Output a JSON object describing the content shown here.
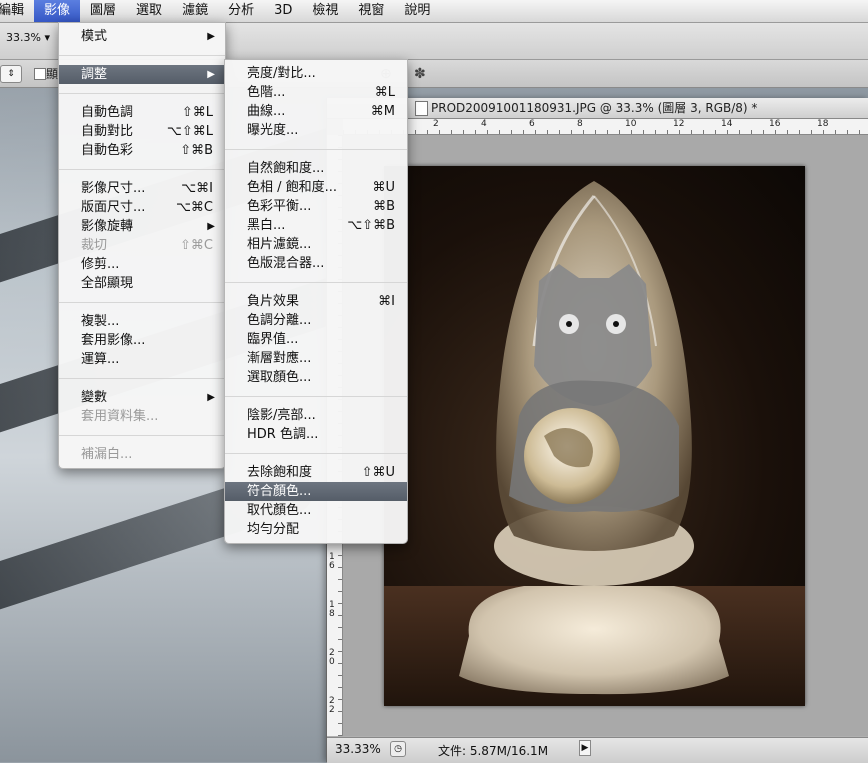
{
  "menubar": [
    "編輯",
    "影像",
    "圖層",
    "選取",
    "濾鏡",
    "分析",
    "3D",
    "檢視",
    "視窗",
    "說明"
  ],
  "menubar_active_index": 1,
  "options": {
    "zoom_value": "33.3%"
  },
  "secondary": {
    "checkbox_label": "顯"
  },
  "document": {
    "title": "PROD20091001180931.JPG @ 33.3% (圖層 3, RGB/8) *",
    "ruler_h": [
      "2",
      "4",
      "6",
      "8",
      "10",
      "12",
      "14",
      "16",
      "18"
    ],
    "ruler_v": [
      "16",
      "18",
      "20",
      "22"
    ],
    "status_zoom": "33.33%",
    "status_info": "文件: 5.87M/16.1M"
  },
  "image_menu": {
    "groups": [
      [
        {
          "label": "模式",
          "submenu": true
        }
      ],
      [
        {
          "label": "調整",
          "submenu": true,
          "highlight": true
        }
      ],
      [
        {
          "label": "自動色調",
          "shortcut": "⇧⌘L"
        },
        {
          "label": "自動對比",
          "shortcut": "⌥⇧⌘L"
        },
        {
          "label": "自動色彩",
          "shortcut": "⇧⌘B"
        }
      ],
      [
        {
          "label": "影像尺寸...",
          "shortcut": "⌥⌘I"
        },
        {
          "label": "版面尺寸...",
          "shortcut": "⌥⌘C"
        },
        {
          "label": "影像旋轉",
          "submenu": true
        },
        {
          "label": "裁切",
          "shortcut": "⇧⌘C",
          "disabled": true
        },
        {
          "label": "修剪..."
        },
        {
          "label": "全部顯現"
        }
      ],
      [
        {
          "label": "複製..."
        },
        {
          "label": "套用影像..."
        },
        {
          "label": "運算..."
        }
      ],
      [
        {
          "label": "變數",
          "submenu": true
        },
        {
          "label": "套用資料集...",
          "disabled": true
        }
      ],
      [
        {
          "label": "補漏白...",
          "disabled": true
        }
      ]
    ]
  },
  "adjust_menu": {
    "groups": [
      [
        {
          "label": "亮度/對比..."
        },
        {
          "label": "色階...",
          "shortcut": "⌘L"
        },
        {
          "label": "曲線...",
          "shortcut": "⌘M"
        },
        {
          "label": "曝光度..."
        }
      ],
      [
        {
          "label": "自然飽和度..."
        },
        {
          "label": "色相 / 飽和度...",
          "shortcut": "⌘U"
        },
        {
          "label": "色彩平衡...",
          "shortcut": "⌘B"
        },
        {
          "label": "黑白...",
          "shortcut": "⌥⇧⌘B"
        },
        {
          "label": "相片濾鏡..."
        },
        {
          "label": "色版混合器..."
        }
      ],
      [
        {
          "label": "負片效果",
          "shortcut": "⌘I"
        },
        {
          "label": "色調分離..."
        },
        {
          "label": "臨界值..."
        },
        {
          "label": "漸層對應..."
        },
        {
          "label": "選取顏色..."
        }
      ],
      [
        {
          "label": "陰影/亮部..."
        },
        {
          "label": "HDR 色調..."
        }
      ],
      [
        {
          "label": "去除飽和度",
          "shortcut": "⇧⌘U"
        },
        {
          "label": "符合顏色...",
          "highlight": true
        },
        {
          "label": "取代顏色..."
        },
        {
          "label": "均勻分配"
        }
      ]
    ]
  }
}
